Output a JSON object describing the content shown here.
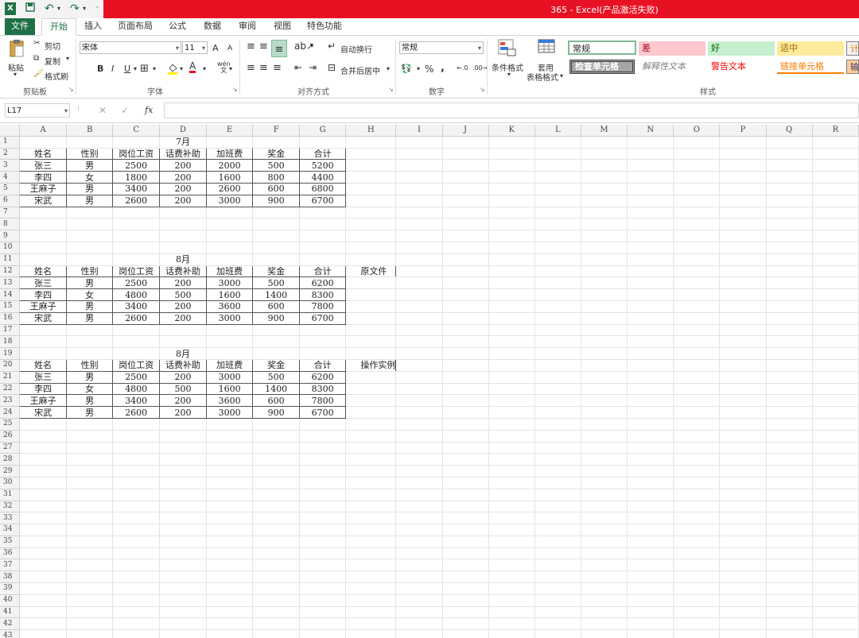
{
  "app": {
    "title": "365 -  Excel(产品激活失败)",
    "qa_undo": "↶",
    "qa_redo": "↷"
  },
  "tabs": [
    "文件",
    "开始",
    "插入",
    "页面布局",
    "公式",
    "数据",
    "审阅",
    "视图",
    "特色功能"
  ],
  "ribbon": {
    "clipboard": {
      "paste": "粘贴",
      "cut": "剪切",
      "copy": "复制",
      "format_painter": "格式刷",
      "label": "剪贴板"
    },
    "font": {
      "name": "宋体",
      "size": "11",
      "grow": "A",
      "shrink": "A",
      "bold": "B",
      "italic": "I",
      "underline": "U",
      "label": "字体",
      "phonetic": "wén"
    },
    "alignment": {
      "wrap": "自动换行",
      "merge": "合并后居中",
      "label": "对齐方式"
    },
    "number": {
      "format": "常规",
      "percent": "%",
      "comma": ",",
      "label": "数字"
    },
    "styles": {
      "conditional": "条件格式",
      "table_format_1": "套用",
      "table_format_2": "表格格式",
      "label": "样式",
      "cells": [
        {
          "text": "常规"
        },
        {
          "text": "差"
        },
        {
          "text": "好"
        },
        {
          "text": "适中"
        },
        {
          "text": "计"
        },
        {
          "text": "检查单元格"
        },
        {
          "text": "解释性文本"
        },
        {
          "text": "警告文本"
        },
        {
          "text": "链接单元格"
        },
        {
          "text": "输"
        }
      ]
    }
  },
  "formula_bar": {
    "name_box": "L17",
    "fx": "fx",
    "cancel": "✕",
    "enter": "✓",
    "value": ""
  },
  "columns": [
    "A",
    "B",
    "C",
    "D",
    "E",
    "F",
    "G",
    "H",
    "I",
    "J",
    "K",
    "L",
    "M",
    "N",
    "O",
    "P",
    "Q",
    "R"
  ],
  "sheet": {
    "t1_title": "7月",
    "t2_title": "8月",
    "t3_title": "8月",
    "headers": [
      "姓名",
      "性别",
      "岗位工资",
      "话费补助",
      "加班费",
      "奖金",
      "合计"
    ],
    "t1_rows": [
      [
        "张三",
        "男",
        "2500",
        "200",
        "2000",
        "500",
        "5200"
      ],
      [
        "李四",
        "女",
        "1800",
        "200",
        "1600",
        "800",
        "4400"
      ],
      [
        "王麻子",
        "男",
        "3400",
        "200",
        "2600",
        "600",
        "6800"
      ],
      [
        "宋武",
        "男",
        "2600",
        "200",
        "3000",
        "900",
        "6700"
      ]
    ],
    "t2_rows": [
      [
        "张三",
        "男",
        "2500",
        "200",
        "3000",
        "500",
        "6200"
      ],
      [
        "李四",
        "女",
        "4800",
        "500",
        "1600",
        "1400",
        "8300"
      ],
      [
        "王麻子",
        "男",
        "3400",
        "200",
        "3600",
        "600",
        "7800"
      ],
      [
        "宋武",
        "男",
        "2600",
        "200",
        "3000",
        "900",
        "6700"
      ]
    ],
    "t3_rows": [
      [
        "张三",
        "男",
        "2500",
        "200",
        "3000",
        "500",
        "6200"
      ],
      [
        "李四",
        "女",
        "4800",
        "500",
        "1600",
        "1400",
        "8300"
      ],
      [
        "王麻子",
        "男",
        "3400",
        "200",
        "3600",
        "600",
        "7800"
      ],
      [
        "宋武",
        "男",
        "2600",
        "200",
        "3000",
        "900",
        "6700"
      ]
    ],
    "label_original": "原文件",
    "label_example": "操作实例"
  }
}
